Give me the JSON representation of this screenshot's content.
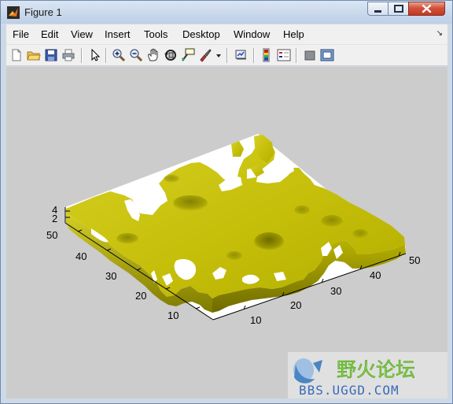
{
  "window": {
    "title": "Figure 1"
  },
  "menu": {
    "items": [
      {
        "label": "File",
        "name": "menu-file"
      },
      {
        "label": "Edit",
        "name": "menu-edit"
      },
      {
        "label": "View",
        "name": "menu-view"
      },
      {
        "label": "Insert",
        "name": "menu-insert"
      },
      {
        "label": "Tools",
        "name": "menu-tools"
      },
      {
        "label": "Desktop",
        "name": "menu-desktop"
      },
      {
        "label": "Window",
        "name": "menu-window"
      },
      {
        "label": "Help",
        "name": "menu-help"
      }
    ],
    "dock_glyph": "↘"
  },
  "toolbar": {
    "icons": [
      "new-figure-icon",
      "open-file-icon",
      "save-icon",
      "print-icon",
      "edit-plot-arrow-icon",
      "zoom-in-icon",
      "zoom-out-icon",
      "pan-hand-icon",
      "rotate-3d-icon",
      "data-cursor-icon",
      "brush-icon",
      "brush-dropdown-icon",
      "link-plot-icon",
      "colorbar-icon",
      "legend-icon",
      "hide-plot-tools-icon",
      "show-plot-tools-icon"
    ]
  },
  "axes": {
    "z_ticks": [
      "4",
      "2"
    ],
    "y_ticks": [
      "50",
      "40",
      "30",
      "20",
      "10"
    ],
    "x_ticks": [
      "10",
      "20",
      "30",
      "40",
      "50"
    ]
  },
  "surface": {
    "color": "#c8c20a"
  },
  "watermark": {
    "brand": "野火论坛",
    "url": "BBS.UGGD.COM"
  },
  "colors": {
    "figure_bg": "#cccccc",
    "axes_bg": "#ffffff",
    "menu_bg": "#f0f0f0",
    "titlebar": "#c8d7ea",
    "close_button": "#c9472f"
  }
}
